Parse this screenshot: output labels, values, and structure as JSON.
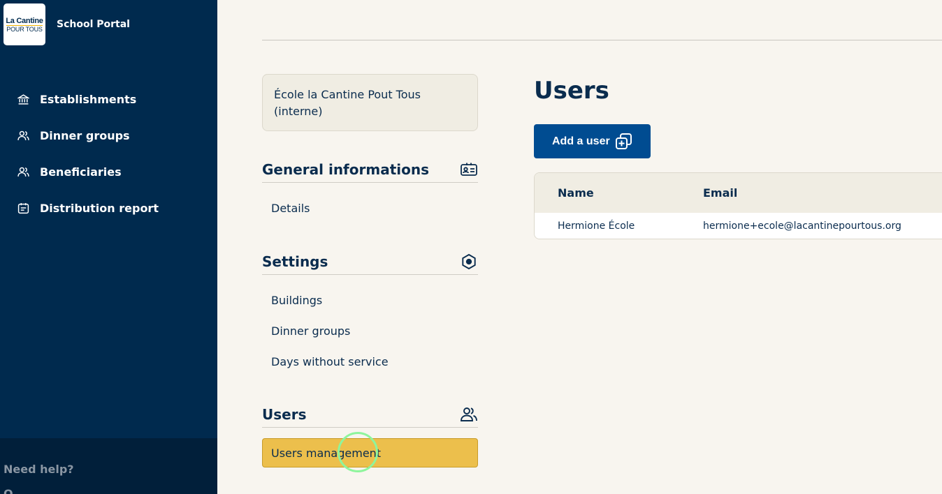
{
  "sidebar": {
    "logo": {
      "line1": "La Cantine",
      "line2": "POUR TOUS"
    },
    "portal_title": "School Portal",
    "nav": [
      {
        "label": "Establishments",
        "icon": "bank-icon"
      },
      {
        "label": "Dinner groups",
        "icon": "users-icon"
      },
      {
        "label": "Beneficiaries",
        "icon": "users-icon"
      },
      {
        "label": "Distribution report",
        "icon": "calendar-icon"
      }
    ],
    "footer": {
      "help": "Need help?",
      "cut_text": "O..."
    }
  },
  "school_card": {
    "name": "École la Cantine Pout Tous (interne)"
  },
  "sections": {
    "general": {
      "title": "General informations",
      "icon": "id-card-icon",
      "links": [
        "Details"
      ]
    },
    "settings": {
      "title": "Settings",
      "icon": "gear-icon",
      "links": [
        "Buildings",
        "Dinner groups",
        "Days without service"
      ]
    },
    "users": {
      "title": "Users",
      "icon": "users-icon",
      "links": [
        "Users management"
      ]
    }
  },
  "main": {
    "title": "Users",
    "add_button": "Add a user",
    "table": {
      "headers": [
        "Name",
        "Email"
      ],
      "rows": [
        {
          "name": "Hermione École",
          "email": "hermione+ecole@lacantinepourtous.org"
        }
      ]
    }
  },
  "colors": {
    "sidebar": "#002a4e",
    "accent": "#ecbf4c",
    "primary_button": "#004c91",
    "background": "#f8f5ef"
  }
}
